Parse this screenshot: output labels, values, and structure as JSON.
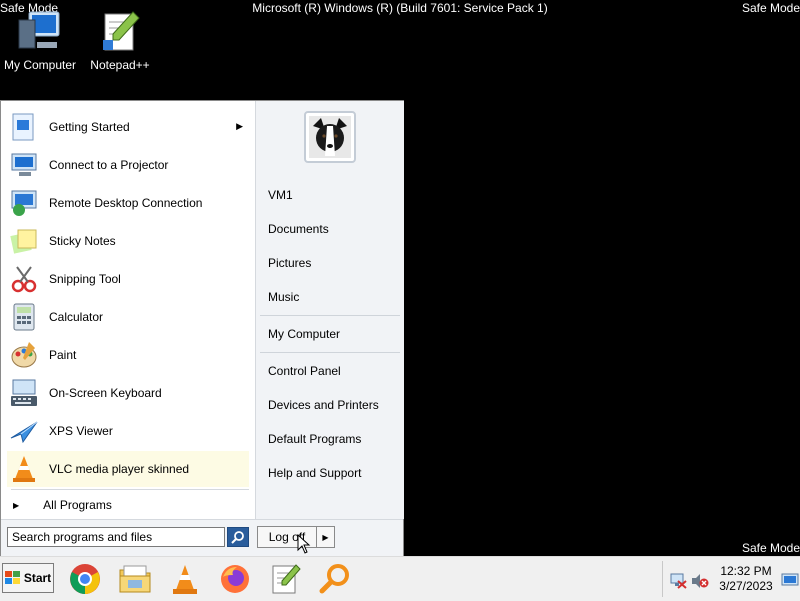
{
  "screen": {
    "safe_mode_label": "Safe Mode",
    "os_title": "Microsoft (R) Windows (R) (Build 7601: Service Pack 1)"
  },
  "desktop_icons": [
    {
      "label": "My Computer",
      "icon": "computer-icon"
    },
    {
      "label": "Notepad++",
      "icon": "notepad-plus-plus-icon"
    }
  ],
  "start_menu": {
    "programs": [
      {
        "label": "Getting Started",
        "icon": "getting-started-icon",
        "has_submenu": true
      },
      {
        "label": "Connect to a Projector",
        "icon": "projector-icon"
      },
      {
        "label": "Remote Desktop Connection",
        "icon": "remote-desktop-icon"
      },
      {
        "label": "Sticky Notes",
        "icon": "sticky-notes-icon"
      },
      {
        "label": "Snipping Tool",
        "icon": "scissors-icon"
      },
      {
        "label": "Calculator",
        "icon": "calculator-icon"
      },
      {
        "label": "Paint",
        "icon": "paint-palette-icon"
      },
      {
        "label": "On-Screen Keyboard",
        "icon": "keyboard-icon"
      },
      {
        "label": "XPS Viewer",
        "icon": "xps-viewer-icon"
      },
      {
        "label": "VLC media player skinned",
        "icon": "vlc-cone-icon",
        "highlighted": true
      }
    ],
    "all_programs_label": "All Programs",
    "right_links": {
      "user": "VM1",
      "documents": "Documents",
      "pictures": "Pictures",
      "music": "Music",
      "my_computer": "My Computer",
      "control_panel": "Control Panel",
      "devices_printers": "Devices and Printers",
      "default_programs": "Default Programs",
      "help_support": "Help and Support"
    },
    "search": {
      "value": "Search programs and files"
    },
    "log_off_label": "Log off"
  },
  "taskbar": {
    "start_label": "Start",
    "apps": [
      "chrome-icon",
      "windows-explorer-icon",
      "vlc-cone-icon",
      "firefox-icon",
      "notepad-plus-plus-icon",
      "search-magnifier-icon"
    ],
    "clock_time": "12:32 PM",
    "clock_date": "3/27/2023"
  },
  "colors": {
    "desktop_bg": "#000000",
    "taskbar_bg": "#f0f0f0",
    "highlight": "#fdfbe4"
  }
}
